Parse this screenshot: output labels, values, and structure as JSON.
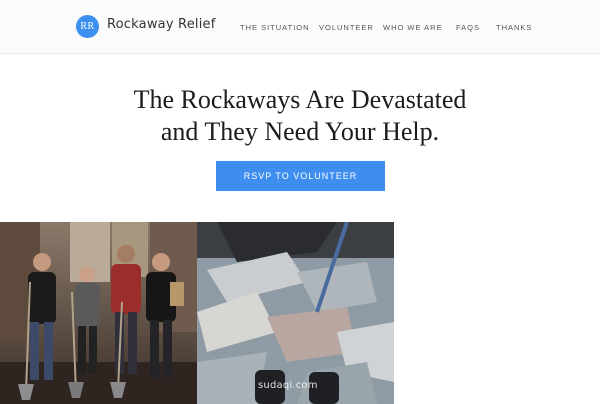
{
  "header": {
    "logo_initials": "RR",
    "brand_name": "Rockaway Relief",
    "nav": [
      {
        "label": "THE SITUATION"
      },
      {
        "label": "VOLUNTEER"
      },
      {
        "label": "WHO WE ARE"
      },
      {
        "label": "FAQS"
      },
      {
        "label": "THANKS"
      }
    ]
  },
  "hero": {
    "title_line1": "The Rockaways Are Devastated",
    "title_line2": "and They Need Your Help.",
    "cta_label": "RSVP TO VOLUNTEER"
  },
  "colors": {
    "accent": "#3e8ef0",
    "header_bg": "#fbfbfb"
  },
  "watermark": "sudaqi.com"
}
